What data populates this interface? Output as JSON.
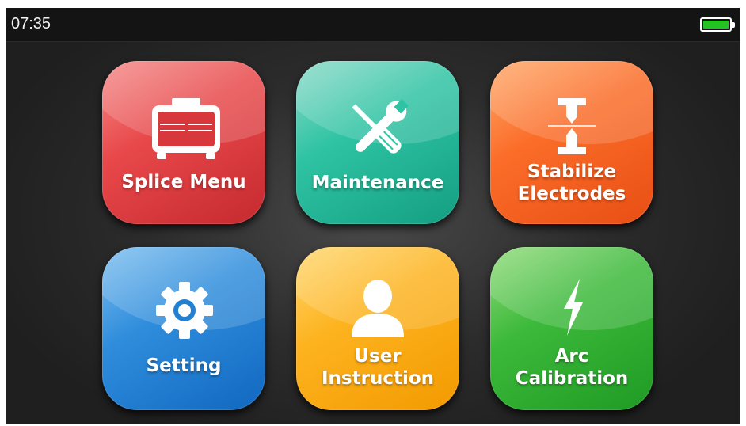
{
  "status": {
    "time": "07:35",
    "battery_icon": "battery-full-icon",
    "battery_color": "#22c322"
  },
  "tiles": [
    {
      "label_lines": [
        "Splice Menu"
      ],
      "icon": "splicer-device-icon",
      "color": "#e8484a"
    },
    {
      "label_lines": [
        "Maintenance"
      ],
      "icon": "wrench-screwdriver-icon",
      "color": "#2ec3a3"
    },
    {
      "label_lines": [
        "Stabilize",
        "Electrodes"
      ],
      "icon": "electrodes-icon",
      "color": "#fb6d29"
    },
    {
      "label_lines": [
        "Setting"
      ],
      "icon": "gear-icon",
      "color": "#2f8ddc"
    },
    {
      "label_lines": [
        "User",
        "Instruction"
      ],
      "icon": "user-icon",
      "color": "#fdb31f"
    },
    {
      "label_lines": [
        "Arc",
        "Calibration"
      ],
      "icon": "lightning-icon",
      "color": "#3cb93a"
    }
  ]
}
